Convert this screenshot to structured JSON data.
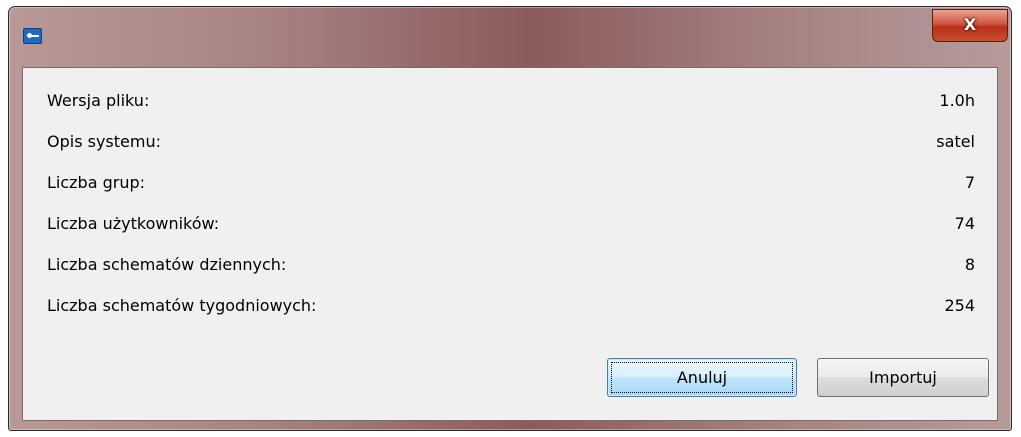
{
  "window": {
    "title": "",
    "icon": "key-card-icon",
    "close_label": "X"
  },
  "info": [
    {
      "label": "Wersja pliku:",
      "value": "1.0h"
    },
    {
      "label": "Opis systemu:",
      "value": "satel"
    },
    {
      "label": "Liczba grup:",
      "value": "7"
    },
    {
      "label": "Liczba użytkowników:",
      "value": "74"
    },
    {
      "label": "Liczba schematów dziennych:",
      "value": "8"
    },
    {
      "label": "Liczba schematów tygodniowych:",
      "value": "254"
    }
  ],
  "buttons": {
    "cancel_label": "Anuluj",
    "import_label": "Importuj"
  },
  "colors": {
    "titlebar": "#a88383",
    "client_bg": "#f0f0f0",
    "close_button": "#c9432b",
    "default_button_border": "#3c7fb1"
  }
}
